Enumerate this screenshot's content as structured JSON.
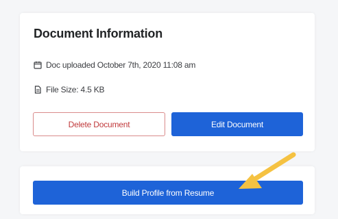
{
  "document_info": {
    "title": "Document Information",
    "uploaded_text": "Doc uploaded October 7th, 2020 11:08 am",
    "file_size_text": "File Size: 4.5 KB",
    "icons": {
      "date": "calendar-icon",
      "file": "file-icon"
    }
  },
  "actions": {
    "delete_label": "Delete Document",
    "edit_label": "Edit Document",
    "build_profile_label": "Build Profile from Resume"
  },
  "colors": {
    "primary": "#1e63d8",
    "danger": "#c0393b",
    "annotation_arrow": "#f5c242"
  }
}
